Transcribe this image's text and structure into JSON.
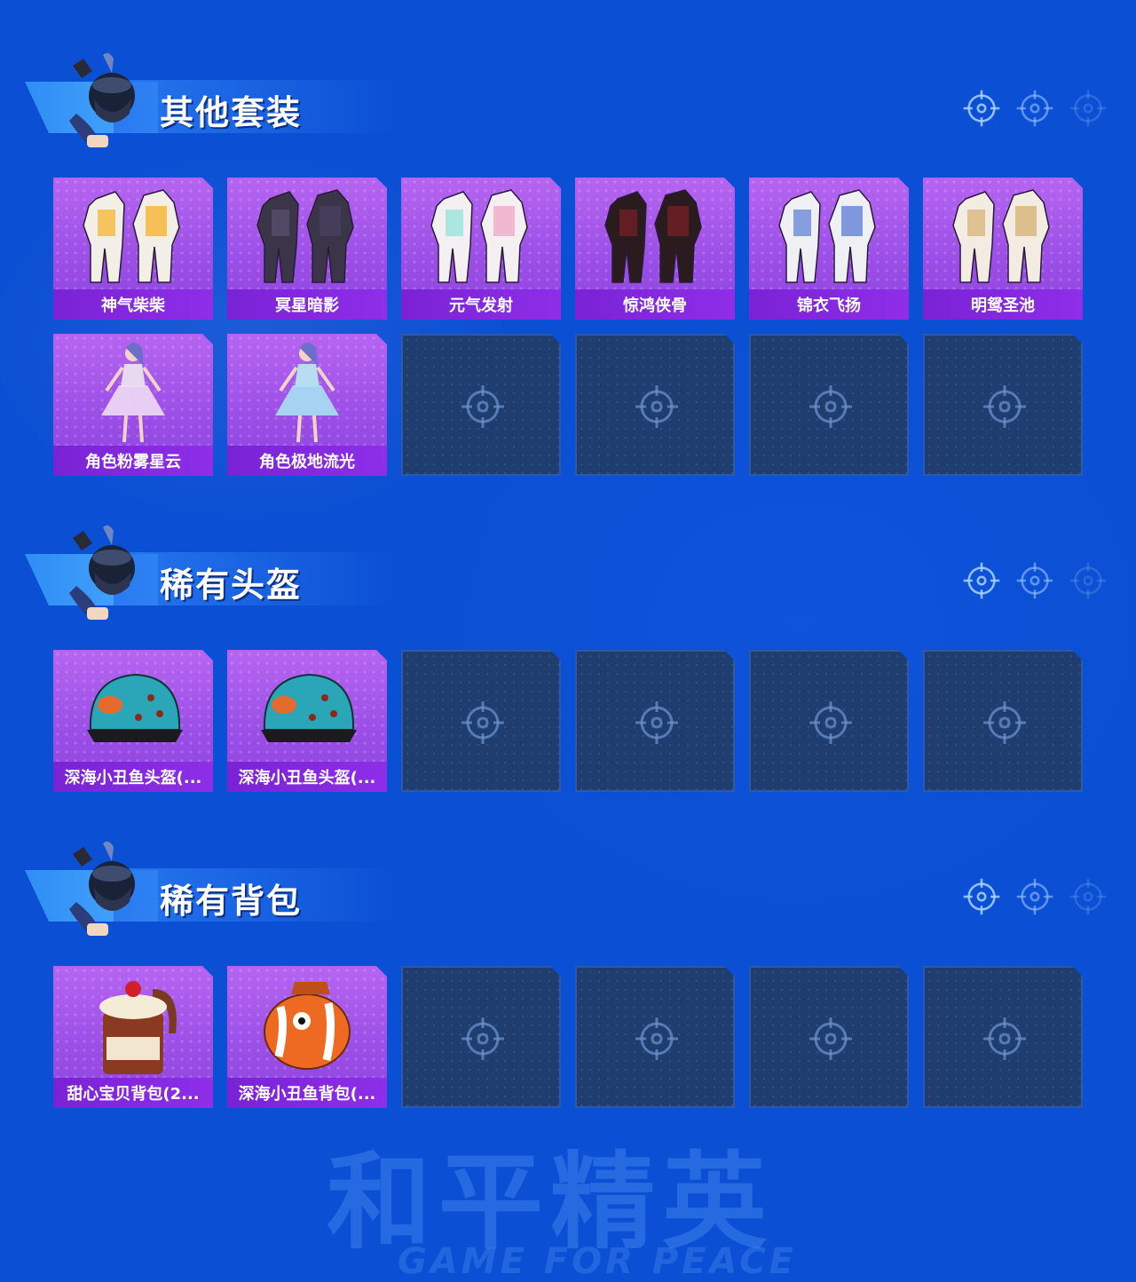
{
  "sections": [
    {
      "title": "其他套装",
      "items": [
        {
          "label": "神气柴柴",
          "icon": "outfit-yellow-white"
        },
        {
          "label": "冥星暗影",
          "icon": "outfit-dark-purple"
        },
        {
          "label": "元气发射",
          "icon": "outfit-pastel"
        },
        {
          "label": "惊鸿侠骨",
          "icon": "outfit-black-red"
        },
        {
          "label": "锦衣飞扬",
          "icon": "outfit-white-blue"
        },
        {
          "label": "明鸳圣池",
          "icon": "outfit-white-gold"
        },
        {
          "label": "角色粉雾星云",
          "icon": "character-pink-dress"
        },
        {
          "label": "角色极地流光",
          "icon": "character-blue-dress"
        }
      ],
      "empty_slots": 4
    },
    {
      "title": "稀有头盔",
      "items": [
        {
          "label": "深海小丑鱼头盔(...",
          "icon": "clownfish-helmet"
        },
        {
          "label": "深海小丑鱼头盔(...",
          "icon": "clownfish-helmet"
        }
      ],
      "empty_slots": 4
    },
    {
      "title": "稀有背包",
      "items": [
        {
          "label": "甜心宝贝背包(2...",
          "icon": "cake-backpack"
        },
        {
          "label": "深海小丑鱼背包(...",
          "icon": "clownfish-backpack"
        }
      ],
      "empty_slots": 4
    }
  ],
  "watermark": {
    "cn": "和平精英",
    "en": "GAME FOR PEACE"
  },
  "colors": {
    "background": "#0b4fd4",
    "card_purple": "#9a4ee6",
    "label_bar": "#7a22d6",
    "empty_slot": "#1f3d6e"
  }
}
